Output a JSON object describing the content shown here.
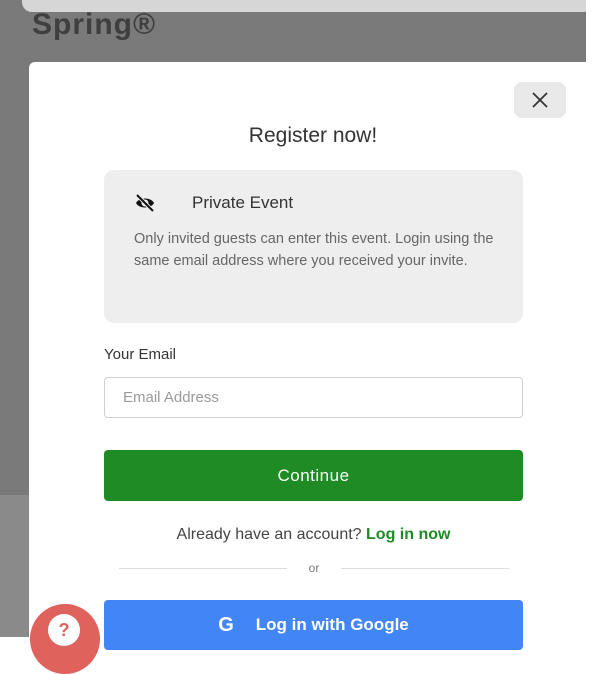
{
  "background": {
    "page_title": "Spring®"
  },
  "modal": {
    "title": "Register now!",
    "info": {
      "icon": "eye-off-icon",
      "heading": "Private Event",
      "text": "Only invited guests can enter this event. Login using the same email address where you received your invite."
    },
    "email": {
      "label": "Your Email",
      "placeholder": "Email Address",
      "value": ""
    },
    "continue_label": "Continue",
    "account_prompt": "Already have an account?",
    "login_link": "Log in now",
    "divider_text": "or",
    "google_button": {
      "icon": "G",
      "label": "Log in with Google"
    }
  },
  "help_button": {
    "label": "?"
  },
  "colors": {
    "primary_green": "#1f8b24",
    "google_blue": "#4285f4",
    "help_red": "#e0625c"
  }
}
